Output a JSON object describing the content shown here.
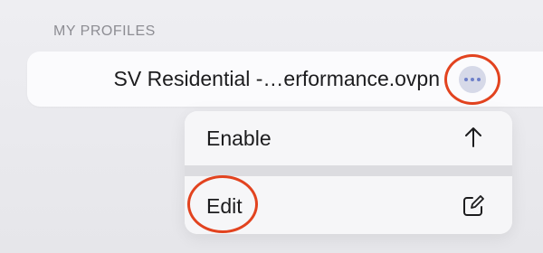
{
  "section": {
    "header": "MY PROFILES"
  },
  "profile": {
    "name": "SV Residential -…erformance.ovpn",
    "more_icon": "ellipsis-icon"
  },
  "menu": {
    "items": [
      {
        "label": "Enable",
        "icon": "arrow-up-icon"
      },
      {
        "label": "Edit",
        "icon": "square-pencil-icon"
      }
    ]
  },
  "colors": {
    "annotation": "#e2431f",
    "accent": "#6d7fc9",
    "text": "#1c1c1e",
    "secondary_text": "#8d8d93"
  }
}
